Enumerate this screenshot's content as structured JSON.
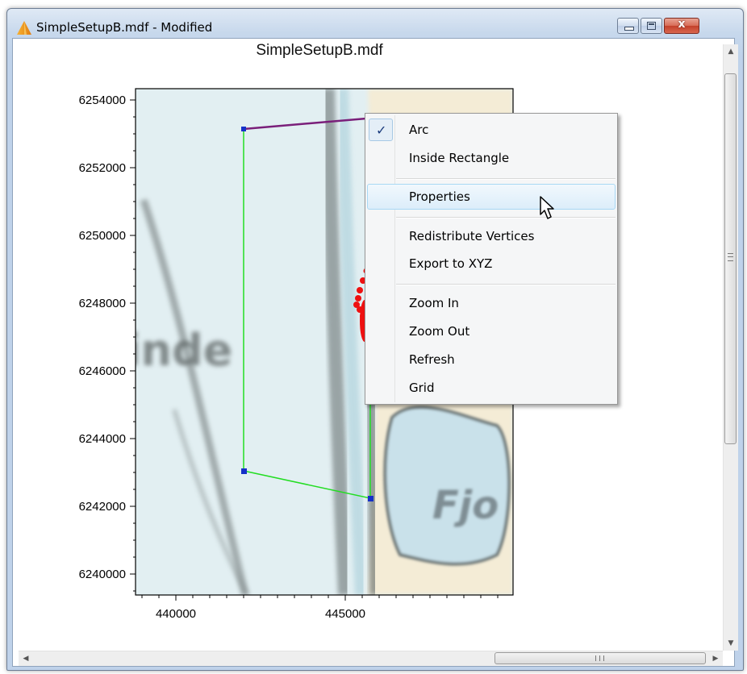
{
  "window": {
    "title": "SimpleSetupB.mdf - Modified",
    "close_glyph": "x"
  },
  "plot": {
    "title": "SimpleSetupB.mdf",
    "y_ticks": [
      "6254000",
      "6252000",
      "6250000",
      "6248000",
      "6246000",
      "6244000",
      "6242000",
      "6240000"
    ],
    "x_ticks": [
      "440000",
      "445000"
    ],
    "map_labels": [
      "inde",
      "Fjo"
    ]
  },
  "context_menu": {
    "items": [
      {
        "label": "Arc",
        "checked": true
      },
      {
        "label": "Inside Rectangle"
      },
      {
        "label": "Properties",
        "highlighted": true
      },
      {
        "label": "Redistribute Vertices"
      },
      {
        "label": "Export to XYZ"
      },
      {
        "label": "Zoom In"
      },
      {
        "label": "Zoom Out"
      },
      {
        "label": "Refresh"
      },
      {
        "label": "Grid"
      }
    ]
  },
  "scrollbars": {
    "vertical_grip": "≡",
    "horizontal_grip": "III"
  },
  "icons": {
    "app": "orange-triangle-icon",
    "check": "checkmark-icon",
    "cursor": "mouse-pointer-icon"
  },
  "colors": {
    "grid_outline": "#22dd22",
    "top_arc": "#7a1f7a",
    "vertex": "#1530c8",
    "samples": "#ee1111",
    "menu_hover": "#dcedfa"
  }
}
